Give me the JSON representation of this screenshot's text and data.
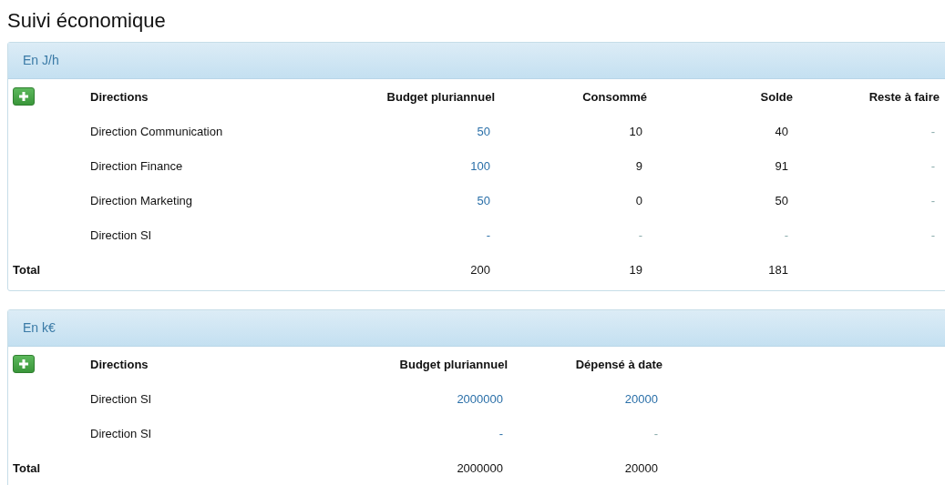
{
  "title": "Suivi économique",
  "panels": [
    {
      "heading": "En J/h",
      "columns": [
        "Directions",
        "Budget pluriannuel",
        "Consommé",
        "Solde",
        "Reste à faire"
      ],
      "rows": [
        [
          {
            "text": "Direction Communication",
            "kind": "plain"
          },
          {
            "text": "50",
            "kind": "link"
          },
          {
            "text": "10",
            "kind": "plain"
          },
          {
            "text": "40",
            "kind": "plain"
          },
          {
            "text": "-",
            "kind": "muted"
          }
        ],
        [
          {
            "text": "Direction Finance",
            "kind": "plain"
          },
          {
            "text": "100",
            "kind": "link"
          },
          {
            "text": "9",
            "kind": "plain"
          },
          {
            "text": "91",
            "kind": "plain"
          },
          {
            "text": "-",
            "kind": "muted"
          }
        ],
        [
          {
            "text": "Direction Marketing",
            "kind": "plain"
          },
          {
            "text": "50",
            "kind": "link"
          },
          {
            "text": "0",
            "kind": "plain"
          },
          {
            "text": "50",
            "kind": "plain"
          },
          {
            "text": "-",
            "kind": "muted"
          }
        ],
        [
          {
            "text": "Direction SI",
            "kind": "plain"
          },
          {
            "text": "-",
            "kind": "link"
          },
          {
            "text": "-",
            "kind": "muted"
          },
          {
            "text": "-",
            "kind": "muted"
          },
          {
            "text": "-",
            "kind": "muted"
          }
        ]
      ],
      "total": {
        "label": "Total",
        "values": [
          "200",
          "19",
          "181"
        ]
      }
    },
    {
      "heading": "En k€",
      "columns": [
        "Directions",
        "Budget pluriannuel",
        "Dépensé à date"
      ],
      "rows": [
        [
          {
            "text": "Direction SI",
            "kind": "plain"
          },
          {
            "text": "2000000",
            "kind": "link"
          },
          {
            "text": "20000",
            "kind": "link"
          }
        ],
        [
          {
            "text": "Direction SI",
            "kind": "plain"
          },
          {
            "text": "-",
            "kind": "link"
          },
          {
            "text": "-",
            "kind": "muted"
          }
        ]
      ],
      "total": {
        "label": "Total",
        "values": [
          "2000000",
          "20000"
        ]
      }
    }
  ]
}
